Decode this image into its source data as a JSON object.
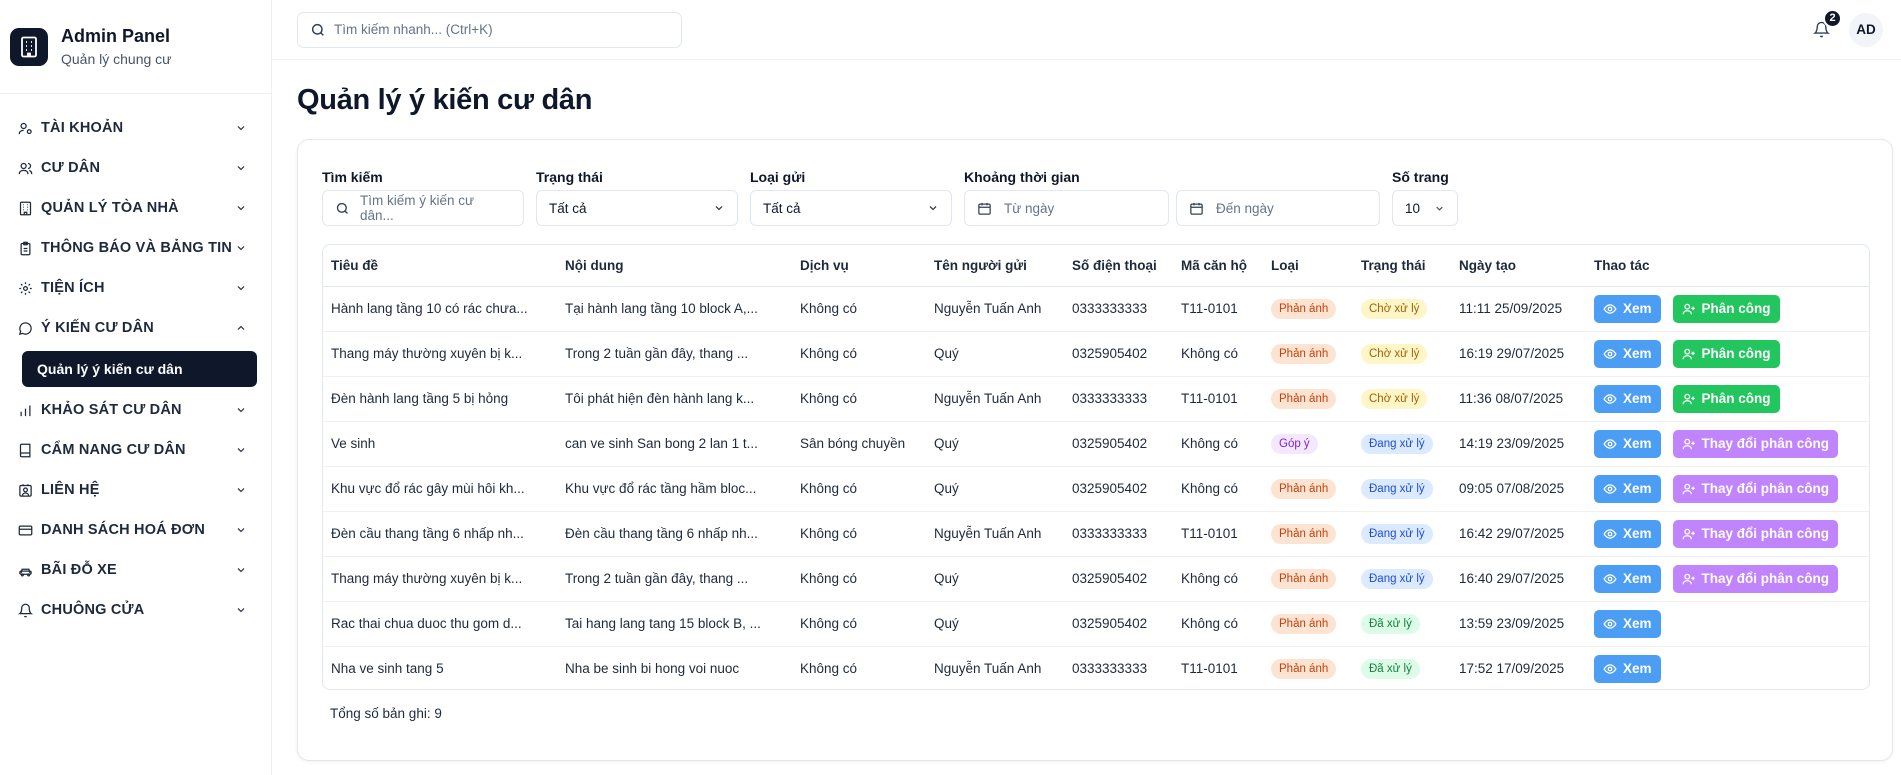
{
  "brand": {
    "title": "Admin Panel",
    "subtitle": "Quản lý chung cư"
  },
  "sidebar": {
    "items": [
      {
        "label": "TÀI KHOẢN",
        "icon": "user-cog-icon",
        "expanded": false
      },
      {
        "label": "CƯ DÂN",
        "icon": "users-icon",
        "expanded": false
      },
      {
        "label": "QUẢN LÝ TÒA NHÀ",
        "icon": "building-icon",
        "expanded": false
      },
      {
        "label": "THÔNG BÁO VÀ BẢNG TIN",
        "icon": "clipboard-icon",
        "expanded": false
      },
      {
        "label": "TIỆN ÍCH",
        "icon": "gear-icon",
        "expanded": false
      },
      {
        "label": "Ý KIẾN CƯ DÂN",
        "icon": "message-circle-icon",
        "expanded": true
      },
      {
        "label": "KHẢO SÁT CƯ DÂN",
        "icon": "bar-chart-icon",
        "expanded": false
      },
      {
        "label": "CẨM NANG CƯ DÂN",
        "icon": "book-icon",
        "expanded": false
      },
      {
        "label": "LIÊN HỆ",
        "icon": "contact-icon",
        "expanded": false
      },
      {
        "label": "DANH SÁCH HOÁ ĐƠN",
        "icon": "credit-card-icon",
        "expanded": false
      },
      {
        "label": "BÃI ĐỖ XE",
        "icon": "car-icon",
        "expanded": false
      },
      {
        "label": "CHUÔNG CỬA",
        "icon": "bell-icon",
        "expanded": false
      }
    ],
    "active_sub": "Quản lý ý kiến cư dân"
  },
  "topbar": {
    "search_placeholder": "Tìm kiếm nhanh... (Ctrl+K)",
    "notif_count": "2",
    "avatar": "AD"
  },
  "page": {
    "title": "Quản lý ý kiến cư dân"
  },
  "filters": {
    "search_label": "Tìm kiếm",
    "search_placeholder": "Tìm kiếm ý kiến cư dân...",
    "status_label": "Trạng thái",
    "status_value": "Tất cả",
    "type_label": "Loại gửi",
    "type_value": "Tất cả",
    "range_label": "Khoảng thời gian",
    "from_placeholder": "Từ ngày",
    "to_placeholder": "Đến ngày",
    "pagesize_label": "Số trang",
    "pagesize_value": "10"
  },
  "table": {
    "headers": [
      "Tiêu đề",
      "Nội dung",
      "Dịch vụ",
      "Tên người gửi",
      "Số điện thoại",
      "Mã căn hộ",
      "Loại",
      "Trạng thái",
      "Ngày tạo",
      "Thao tác"
    ],
    "rows": [
      {
        "title": "Hành lang tầng 10 có rác chưa...",
        "content": "Tại hành lang tầng 10 block A,...",
        "service": "Không có",
        "sender": "Nguyễn Tuấn Anh",
        "phone": "0333333333",
        "apt": "T11-0101",
        "type": "Phản ánh",
        "status": "Chờ xử lý",
        "created": "11:11 25/09/2025",
        "action": "Phân công"
      },
      {
        "title": "Thang máy thường xuyên bị k...",
        "content": "Trong 2 tuần gần đây, thang ...",
        "service": "Không có",
        "sender": "Quý",
        "phone": "0325905402",
        "apt": "Không có",
        "type": "Phản ánh",
        "status": "Chờ xử lý",
        "created": "16:19 29/07/2025",
        "action": "Phân công"
      },
      {
        "title": "Đèn hành lang tầng 5 bị hỏng",
        "content": "Tôi phát hiện đèn hành lang k...",
        "service": "Không có",
        "sender": "Nguyễn Tuấn Anh",
        "phone": "0333333333",
        "apt": "T11-0101",
        "type": "Phản ánh",
        "status": "Chờ xử lý",
        "created": "11:36 08/07/2025",
        "action": "Phân công"
      },
      {
        "title": "Ve sinh",
        "content": "can ve sinh San bong 2 lan 1 t...",
        "service": "Sân bóng chuyền",
        "sender": "Quý",
        "phone": "0325905402",
        "apt": "Không có",
        "type": "Góp ý",
        "status": "Đang xử lý",
        "created": "14:19 23/09/2025",
        "action": "Thay đổi phân công"
      },
      {
        "title": "Khu vực đổ rác gây mùi hôi kh...",
        "content": "Khu vực đổ rác tầng hầm bloc...",
        "service": "Không có",
        "sender": "Quý",
        "phone": "0325905402",
        "apt": "Không có",
        "type": "Phản ánh",
        "status": "Đang xử lý",
        "created": "09:05 07/08/2025",
        "action": "Thay đổi phân công"
      },
      {
        "title": "Đèn cầu thang tầng 6 nhấp nh...",
        "content": "Đèn cầu thang tầng 6 nhấp nh...",
        "service": "Không có",
        "sender": "Nguyễn Tuấn Anh",
        "phone": "0333333333",
        "apt": "T11-0101",
        "type": "Phản ánh",
        "status": "Đang xử lý",
        "created": "16:42 29/07/2025",
        "action": "Thay đổi phân công"
      },
      {
        "title": "Thang máy thường xuyên bị k...",
        "content": "Trong 2 tuần gần đây, thang ...",
        "service": "Không có",
        "sender": "Quý",
        "phone": "0325905402",
        "apt": "Không có",
        "type": "Phản ánh",
        "status": "Đang xử lý",
        "created": "16:40 29/07/2025",
        "action": "Thay đổi phân công"
      },
      {
        "title": "Rac thai chua duoc thu gom d...",
        "content": "Tai hang lang tang 15 block B, ...",
        "service": "Không có",
        "sender": "Quý",
        "phone": "0325905402",
        "apt": "Không có",
        "type": "Phản ánh",
        "status": "Đã xử lý",
        "created": "13:59 23/09/2025",
        "action": ""
      },
      {
        "title": "Nha ve sinh tang 5",
        "content": "Nha be sinh bi hong voi nuoc",
        "service": "Không có",
        "sender": "Nguyễn Tuấn Anh",
        "phone": "0333333333",
        "apt": "T11-0101",
        "type": "Phản ánh",
        "status": "Đã xử lý",
        "created": "17:52 17/09/2025",
        "action": ""
      }
    ],
    "view_label": "Xem"
  },
  "total_label": "Tổng số bản ghi: 9",
  "colors": {
    "type_feedback_bg": "#fde3d2",
    "type_feedback_fg": "#c2410c",
    "type_suggest_bg": "#f3e8ff",
    "type_suggest_fg": "#7e22ce",
    "status_pending_bg": "#fef6c7",
    "status_pending_fg": "#a16207",
    "status_processing_bg": "#dbeafe",
    "status_processing_fg": "#1d4ed8",
    "status_done_bg": "#dcfce7",
    "status_done_fg": "#15803d",
    "view_btn": "#4c9ef5",
    "assign_btn": "#22c55e",
    "reassign_btn": "#c084fc"
  }
}
